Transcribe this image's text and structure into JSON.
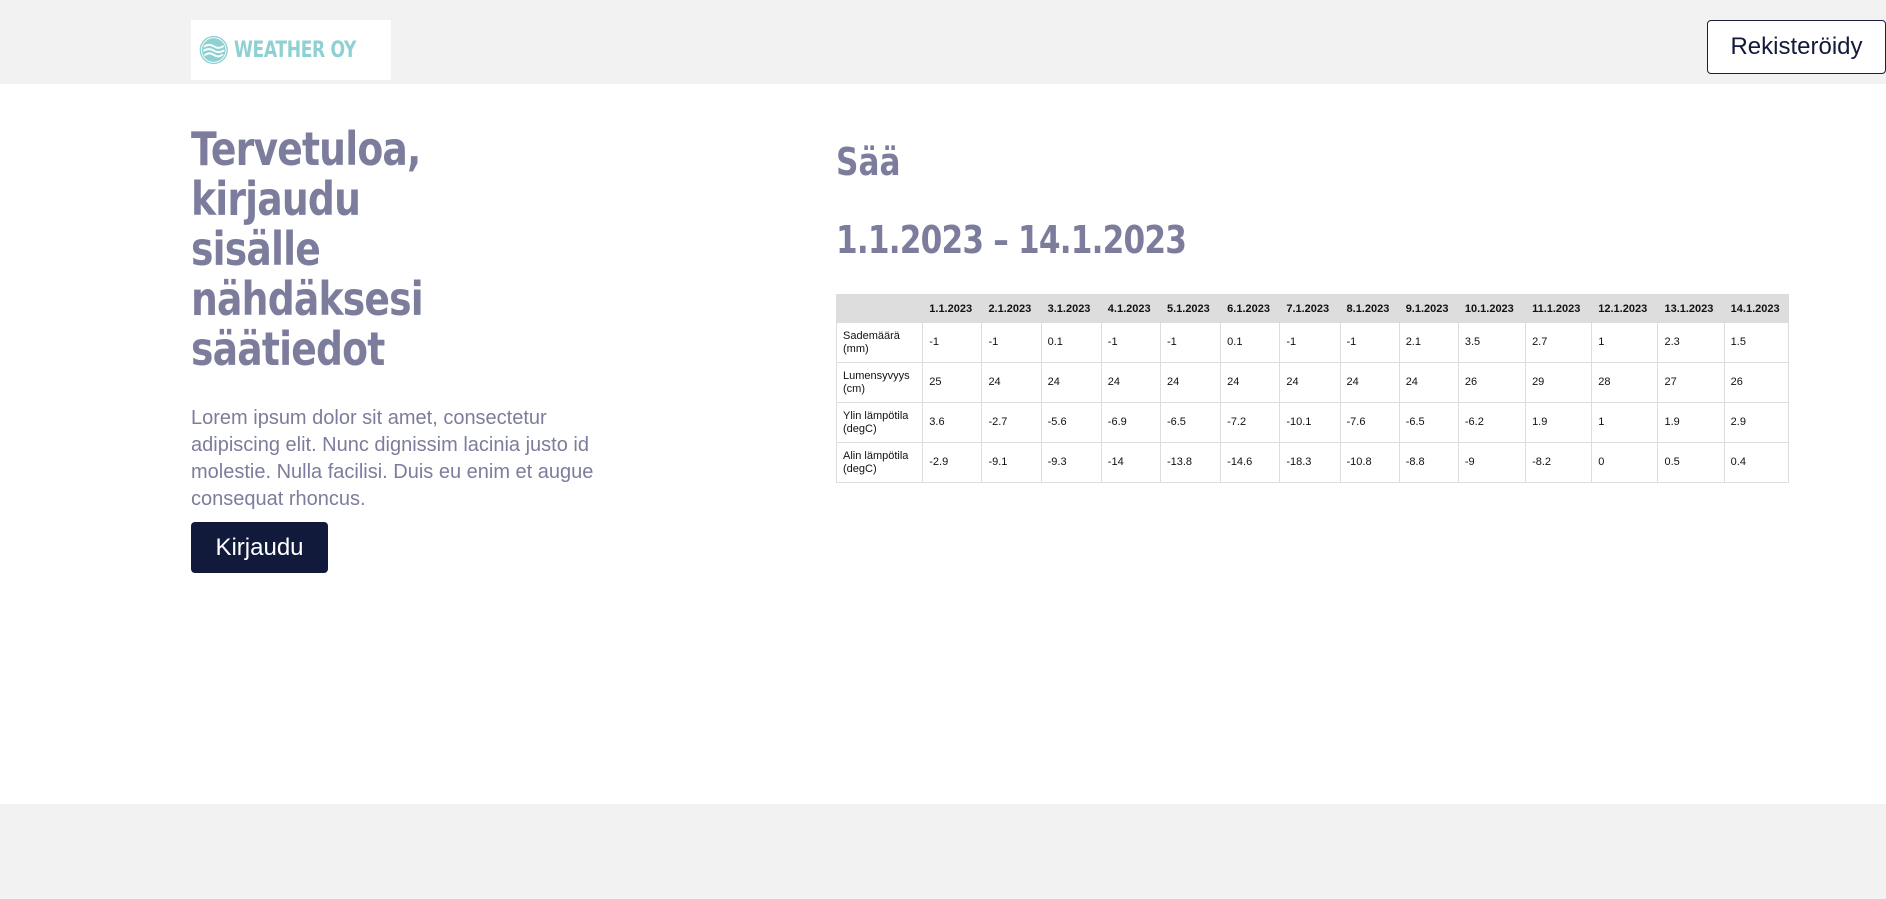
{
  "header": {
    "logo_text": "WEATHER OY",
    "register_label": "Rekisteröidy"
  },
  "hero": {
    "title_line1": "Tervetuloa,",
    "title_line2": "kirjaudu sisälle",
    "title_line3": "nähdäksesi",
    "title_line4": "säätiedot",
    "text": "Lorem ipsum dolor sit amet, consectetur adipiscing elit. Nunc dignissim lacinia justo id molestie. Nulla facilisi. Duis eu enim et augue consequat rhoncus.",
    "login_label": "Kirjaudu"
  },
  "weather": {
    "title": "Sää",
    "range": "1.1.2023 – 14.1.2023",
    "columns": [
      "",
      "1.1.2023",
      "2.1.2023",
      "3.1.2023",
      "4.1.2023",
      "5.1.2023",
      "6.1.2023",
      "7.1.2023",
      "8.1.2023",
      "9.1.2023",
      "10.1.2023",
      "11.1.2023",
      "12.1.2023",
      "13.1.2023",
      "14.1.2023"
    ],
    "rows": [
      {
        "label": "Sademäärä (mm)",
        "values": [
          "-1",
          "-1",
          "0.1",
          "-1",
          "-1",
          "0.1",
          "-1",
          "-1",
          "2.1",
          "3.5",
          "2.7",
          "1",
          "2.3",
          "1.5"
        ]
      },
      {
        "label": "Lumensyvyys (cm)",
        "values": [
          "25",
          "24",
          "24",
          "24",
          "24",
          "24",
          "24",
          "24",
          "24",
          "26",
          "29",
          "28",
          "27",
          "26"
        ]
      },
      {
        "label": "Ylin lämpötila (degC)",
        "values": [
          "3.6",
          "-2.7",
          "-5.6",
          "-6.9",
          "-6.5",
          "-7.2",
          "-10.1",
          "-7.6",
          "-6.5",
          "-6.2",
          "1.9",
          "1",
          "1.9",
          "2.9"
        ]
      },
      {
        "label": "Alin lämpötila (degC)",
        "values": [
          "-2.9",
          "-9.1",
          "-9.3",
          "-14",
          "-13.8",
          "-14.6",
          "-18.3",
          "-10.8",
          "-8.8",
          "-9",
          "-8.2",
          "0",
          "0.5",
          "0.4"
        ]
      }
    ]
  },
  "colors": {
    "header_bg": "#f2f2f2",
    "logo_teal": "#8fd0d2",
    "heading": "#7c7d9c",
    "primary_button": "#121a3b",
    "table_header_bg": "#dddddd"
  },
  "icons": {
    "logo": "waves-circle-icon"
  }
}
